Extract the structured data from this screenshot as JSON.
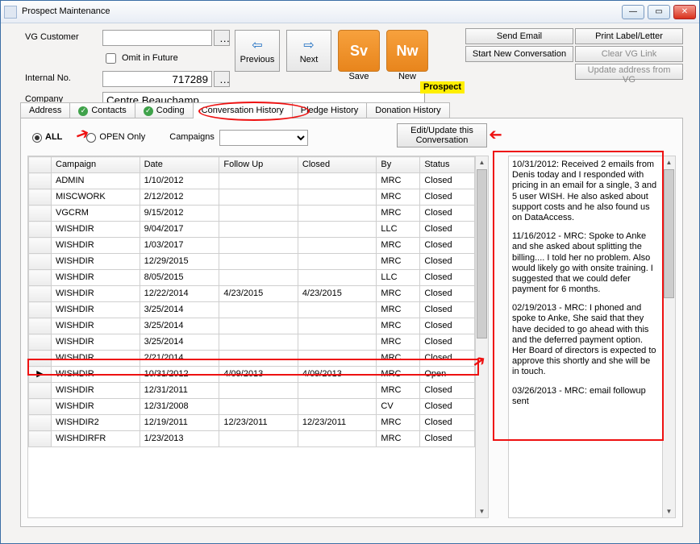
{
  "window": {
    "title": "Prospect Maintenance"
  },
  "form": {
    "vg_label": "VG Customer",
    "vg_value": "",
    "omit_label": "Omit in Future",
    "internal_label": "Internal No.",
    "internal_value": "717289",
    "company_label": "Company",
    "company_value": "Centre Beauchamp",
    "prospect_badge": "Prospect"
  },
  "nav": {
    "prev": "Previous",
    "next": "Next",
    "save_big": "Sv",
    "save": "Save",
    "new_big": "Nw",
    "new": "New"
  },
  "actions": {
    "send_email": "Send Email",
    "print": "Print Label/Letter",
    "start_conv": "Start New Conversation",
    "clear_vg": "Clear VG Link",
    "update_addr": "Update address from VG"
  },
  "tabs": [
    "Address",
    "Contacts",
    "Coding",
    "Conversation History",
    "Pledge History",
    "Donation History"
  ],
  "tab_checks": [
    false,
    true,
    true,
    false,
    false,
    false
  ],
  "active_tab": 3,
  "conv": {
    "filter_all": "ALL",
    "filter_open": "OPEN Only",
    "filter_sel": "ALL",
    "campaigns_label": "Campaigns",
    "edit_btn": "Edit/Update this Conversation",
    "columns": [
      "Campaign",
      "Date",
      "Follow Up",
      "Closed",
      "By",
      "Status"
    ],
    "rows": [
      {
        "campaign": "ADMIN",
        "date": "1/10/2012",
        "follow": "",
        "closed": "",
        "by": "MRC",
        "status": "Closed"
      },
      {
        "campaign": "MISCWORK",
        "date": "2/12/2012",
        "follow": "",
        "closed": "",
        "by": "MRC",
        "status": "Closed"
      },
      {
        "campaign": "VGCRM",
        "date": "9/15/2012",
        "follow": "",
        "closed": "",
        "by": "MRC",
        "status": "Closed"
      },
      {
        "campaign": "WISHDIR",
        "date": "9/04/2017",
        "follow": "",
        "closed": "",
        "by": "LLC",
        "status": "Closed"
      },
      {
        "campaign": "WISHDIR",
        "date": "1/03/2017",
        "follow": "",
        "closed": "",
        "by": "MRC",
        "status": "Closed"
      },
      {
        "campaign": "WISHDIR",
        "date": "12/29/2015",
        "follow": "",
        "closed": "",
        "by": "MRC",
        "status": "Closed"
      },
      {
        "campaign": "WISHDIR",
        "date": "8/05/2015",
        "follow": "",
        "closed": "",
        "by": "LLC",
        "status": "Closed"
      },
      {
        "campaign": "WISHDIR",
        "date": "12/22/2014",
        "follow": "4/23/2015",
        "closed": "4/23/2015",
        "by": "MRC",
        "status": "Closed"
      },
      {
        "campaign": "WISHDIR",
        "date": "3/25/2014",
        "follow": "",
        "closed": "",
        "by": "MRC",
        "status": "Closed"
      },
      {
        "campaign": "WISHDIR",
        "date": "3/25/2014",
        "follow": "",
        "closed": "",
        "by": "MRC",
        "status": "Closed"
      },
      {
        "campaign": "WISHDIR",
        "date": "3/25/2014",
        "follow": "",
        "closed": "",
        "by": "MRC",
        "status": "Closed"
      },
      {
        "campaign": "WISHDIR",
        "date": "2/21/2014",
        "follow": "",
        "closed": "",
        "by": "MRC",
        "status": "Closed"
      },
      {
        "campaign": "WISHDIR",
        "date": "10/31/2012",
        "follow": "4/09/2013",
        "closed": "4/09/2013",
        "by": "MRC",
        "status": "Open",
        "selected": true
      },
      {
        "campaign": "WISHDIR",
        "date": "12/31/2011",
        "follow": "",
        "closed": "",
        "by": "MRC",
        "status": "Closed"
      },
      {
        "campaign": "WISHDIR",
        "date": "12/31/2008",
        "follow": "",
        "closed": "",
        "by": "CV",
        "status": "Closed"
      },
      {
        "campaign": "WISHDIR2",
        "date": "12/19/2011",
        "follow": "12/23/2011",
        "closed": "12/23/2011",
        "by": "MRC",
        "status": "Closed"
      },
      {
        "campaign": "WISHDIRFR",
        "date": "1/23/2013",
        "follow": "",
        "closed": "",
        "by": "MRC",
        "status": "Closed"
      }
    ],
    "detail": [
      "10/31/2012: Received 2 emails from Denis today and I responded with pricing in an email for a single, 3 and 5 user WISH.  He also asked about support costs and he also found us on DataAccess.",
      "11/16/2012 - MRC: Spoke to Anke and she asked about splitting the billing.... I told her no problem.  Also would likely go with onsite training.  I suggested that we could defer payment for 6 months.",
      "02/19/2013 - MRC: I phoned and spoke to Anke,  She said that they have decided to go ahead with this and the deferred payment option.  Her Board of directors is expected to approve this shortly and she will be in touch.",
      "03/26/2013 - MRC: email followup sent"
    ]
  }
}
